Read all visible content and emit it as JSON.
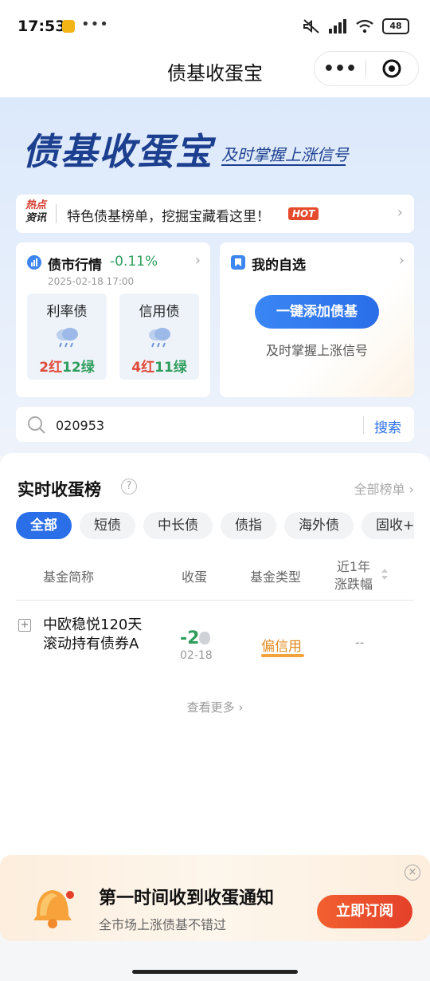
{
  "status_bar": {
    "time": "17:53",
    "more": "•••",
    "battery": "48"
  },
  "header": {
    "title": "债基收蛋宝",
    "more": "•••"
  },
  "banner": {
    "title": "债基收蛋宝",
    "slogan": "及时掌握上涨信号"
  },
  "hot_bar": {
    "tag_line1": "热点",
    "tag_line2": "资讯",
    "text": "特色债基榜单，挖掘宝藏看这里！",
    "badge": "HOT"
  },
  "market_card": {
    "title": "债市行情",
    "change": "-0.11%",
    "datetime": "2025-02-18 17:00",
    "items": [
      {
        "label": "利率债",
        "red": "2红",
        "green": "12绿"
      },
      {
        "label": "信用债",
        "red": "4红",
        "green": "11绿"
      }
    ]
  },
  "watchlist_card": {
    "title": "我的自选",
    "button": "一键添加债基",
    "subtitle": "及时掌握上涨信号"
  },
  "search": {
    "value": "020953",
    "button": "搜索"
  },
  "ranking": {
    "title": "实时收蛋榜",
    "all_label": "全部榜单",
    "chips": [
      "全部",
      "短债",
      "中长债",
      "债指",
      "海外债",
      "固收+"
    ],
    "columns": {
      "name": "基金简称",
      "egg": "收蛋",
      "type": "基金类型",
      "change_line1": "近1年",
      "change_line2": "涨跌幅"
    },
    "rows": [
      {
        "name": "中欧稳悦120天滚动持有债券A",
        "egg": "-2",
        "egg_date": "02-18",
        "type": "偏信用",
        "change": "--"
      }
    ],
    "see_more": "查看更多"
  },
  "notification": {
    "title": "第一时间收到收蛋通知",
    "subtitle": "全市场上涨债基不错过",
    "button": "立即订阅"
  },
  "colors": {
    "primary": "#2a6ee8",
    "green": "#2f9e5c",
    "red": "#e04a3a",
    "orange": "#e4402a"
  }
}
